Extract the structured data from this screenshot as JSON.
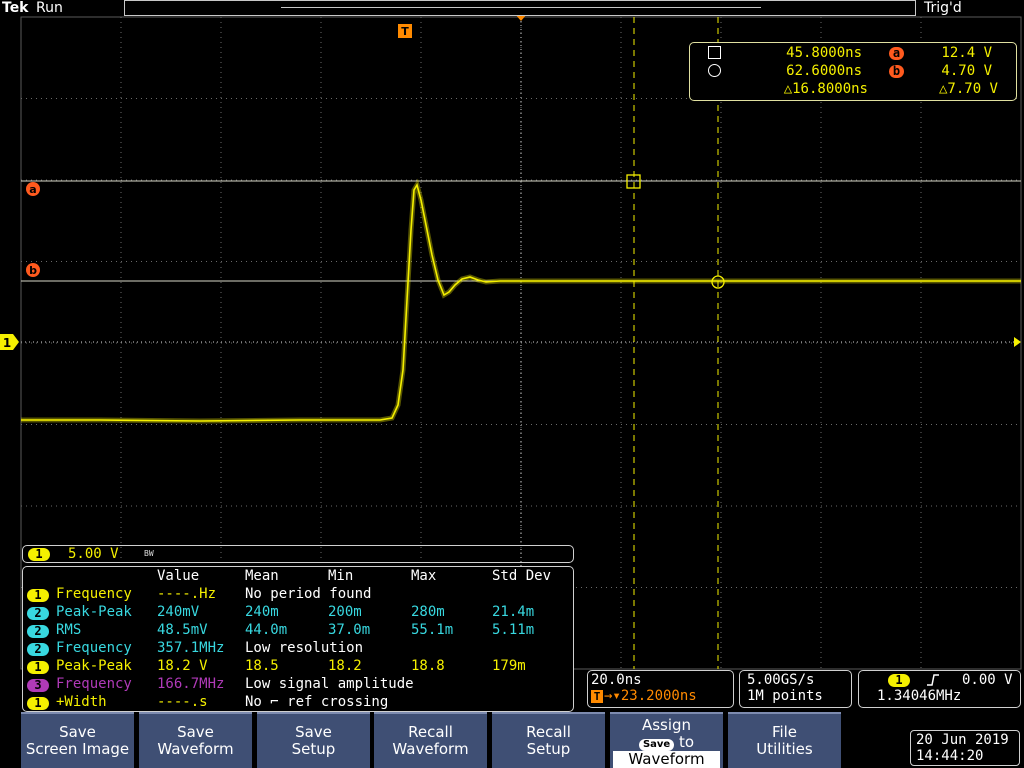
{
  "header": {
    "brand": "Tek",
    "acq_state": "Run",
    "trigger_state": "Trig'd"
  },
  "markers": {
    "trigger_position": "T",
    "cursor_a": "a",
    "cursor_b": "b",
    "channel1": "1"
  },
  "cursor_readout": {
    "t1": "45.8000ns",
    "t2": "62.6000ns",
    "dt": "△16.8000ns",
    "v_a": "12.4 V",
    "v_b": "4.70 V",
    "dv": "△7.70 V"
  },
  "channel_bar": {
    "channel": "1",
    "scale": "5.00 V",
    "bw": "BW"
  },
  "measurements": {
    "headers": [
      "Value",
      "Mean",
      "Min",
      "Max",
      "Std Dev"
    ],
    "rows": [
      {
        "ch": "1",
        "name": "Frequency",
        "value": "----.Hz",
        "note": "No period found",
        "color": "#f5f000"
      },
      {
        "ch": "2",
        "name": "Peak-Peak",
        "value": "240mV",
        "mean": "240m",
        "min": "200m",
        "max": "280m",
        "std": "21.4m",
        "color": "#38d8e0"
      },
      {
        "ch": "2",
        "name": "RMS",
        "value": "48.5mV",
        "mean": "44.0m",
        "min": "37.0m",
        "max": "55.1m",
        "std": "5.11m",
        "color": "#38d8e0"
      },
      {
        "ch": "2",
        "name": "Frequency",
        "value": "357.1MHz",
        "note": "Low resolution",
        "color": "#38d8e0"
      },
      {
        "ch": "1",
        "name": "Peak-Peak",
        "value": "18.2 V",
        "mean": "18.5",
        "min": "18.2",
        "max": "18.8",
        "std": "179m",
        "color": "#f5f000"
      },
      {
        "ch": "3",
        "name": "Frequency",
        "value": "166.7MHz",
        "note": "Low signal amplitude",
        "color": "#b03ab8"
      },
      {
        "ch": "1",
        "name": "+Width",
        "value": "----.s",
        "note": "No ⌐ ref crossing",
        "color": "#f5f000"
      }
    ]
  },
  "timebase": {
    "scale": "20.0ns",
    "position": "→▾23.2000ns",
    "trig_icon": "T"
  },
  "acquisition": {
    "rate": "5.00GS/s",
    "record": "1M points"
  },
  "trigger": {
    "source": "1",
    "slope_icon": "rising-edge",
    "level": "0.00 V",
    "frequency": "1.34046MHz"
  },
  "softkeys": [
    {
      "line1": "Save",
      "line2": "Screen Image"
    },
    {
      "line1": "Save",
      "line2": "Waveform"
    },
    {
      "line1": "Save",
      "line2": "Setup"
    },
    {
      "line1": "Recall",
      "line2": "Waveform"
    },
    {
      "line1": "Recall",
      "line2": "Setup"
    },
    {
      "line1": "Assign",
      "badge": "Save",
      "mid": "to",
      "line2": "Waveform"
    },
    {
      "line1": "File",
      "line2": "Utilities"
    }
  ],
  "datetime": {
    "date": "20 Jun  2019",
    "time": "14:44:20"
  },
  "colors": {
    "ch1": "#f5f000",
    "ch2": "#38d8e0",
    "ch3": "#b03ab8",
    "cursor_marker": "#ff5a1e",
    "softkey": "#3f4f74"
  }
}
